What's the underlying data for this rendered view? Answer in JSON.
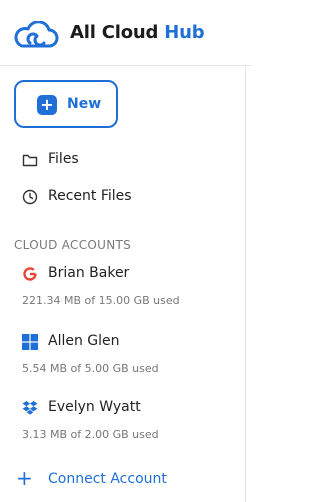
{
  "app": {
    "brand_primary": "All Cloud",
    "brand_accent": "Hub",
    "accent_color": "#1f6fd6"
  },
  "actions": {
    "new_label": "New",
    "new_icon": "plus-icon"
  },
  "nav": [
    {
      "label": "Files",
      "icon": "folder-icon"
    },
    {
      "label": "Recent Files",
      "icon": "clock-icon"
    }
  ],
  "cloud_accounts": {
    "title": "CLOUD ACCOUNTS",
    "items": [
      {
        "name": "Brian Baker",
        "provider_icon": "google-icon",
        "usage": "221.34 MB of 15.00 GB used"
      },
      {
        "name": "Allen Glen",
        "provider_icon": "windows-icon",
        "usage": "5.54 MB of 5.00 GB used"
      },
      {
        "name": "Evelyn Wyatt",
        "provider_icon": "dropbox-icon",
        "usage": "3.13 MB of 2.00 GB used"
      }
    ],
    "connect_label": "Connect Account"
  }
}
